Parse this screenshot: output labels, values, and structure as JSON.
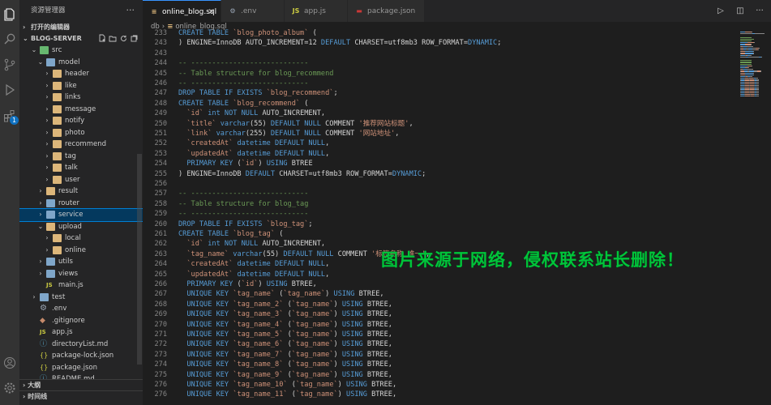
{
  "sidebar": {
    "title": "资源管理器",
    "open_editors_label": "打开的编辑器",
    "project_name": "BLOG-SERVER",
    "tree": [
      {
        "label": "src",
        "depth": 1,
        "expanded": true,
        "kind": "folder-green"
      },
      {
        "label": "model",
        "depth": 2,
        "expanded": true,
        "kind": "folder-special"
      },
      {
        "label": "header",
        "depth": 3,
        "expanded": false,
        "kind": "folder"
      },
      {
        "label": "like",
        "depth": 3,
        "expanded": false,
        "kind": "folder"
      },
      {
        "label": "links",
        "depth": 3,
        "expanded": false,
        "kind": "folder"
      },
      {
        "label": "message",
        "depth": 3,
        "expanded": false,
        "kind": "folder"
      },
      {
        "label": "notify",
        "depth": 3,
        "expanded": false,
        "kind": "folder"
      },
      {
        "label": "photo",
        "depth": 3,
        "expanded": false,
        "kind": "folder"
      },
      {
        "label": "recommend",
        "depth": 3,
        "expanded": false,
        "kind": "folder"
      },
      {
        "label": "tag",
        "depth": 3,
        "expanded": false,
        "kind": "folder"
      },
      {
        "label": "talk",
        "depth": 3,
        "expanded": false,
        "kind": "folder"
      },
      {
        "label": "user",
        "depth": 3,
        "expanded": false,
        "kind": "folder"
      },
      {
        "label": "result",
        "depth": 2,
        "expanded": false,
        "kind": "folder"
      },
      {
        "label": "router",
        "depth": 2,
        "expanded": false,
        "kind": "folder-special"
      },
      {
        "label": "service",
        "depth": 2,
        "expanded": false,
        "kind": "folder-special",
        "selected": true
      },
      {
        "label": "upload",
        "depth": 2,
        "expanded": true,
        "kind": "folder"
      },
      {
        "label": "local",
        "depth": 3,
        "expanded": false,
        "kind": "folder"
      },
      {
        "label": "online",
        "depth": 3,
        "expanded": false,
        "kind": "folder"
      },
      {
        "label": "utils",
        "depth": 2,
        "expanded": false,
        "kind": "folder-special"
      },
      {
        "label": "views",
        "depth": 2,
        "expanded": false,
        "kind": "folder-special"
      },
      {
        "label": "main.js",
        "depth": 2,
        "kind": "js"
      },
      {
        "label": "test",
        "depth": 1,
        "expanded": false,
        "kind": "folder-special"
      },
      {
        "label": ".env",
        "depth": 1,
        "kind": "gear"
      },
      {
        "label": ".gitignore",
        "depth": 1,
        "kind": "file"
      },
      {
        "label": "app.js",
        "depth": 1,
        "kind": "js"
      },
      {
        "label": "directoryList.md",
        "depth": 1,
        "kind": "md"
      },
      {
        "label": "package-lock.json",
        "depth": 1,
        "kind": "json"
      },
      {
        "label": "package.json",
        "depth": 1,
        "kind": "json"
      },
      {
        "label": "README.md",
        "depth": 1,
        "kind": "md"
      }
    ],
    "outline_label": "大纲",
    "timeline_label": "时间线"
  },
  "tabs": [
    {
      "label": "online_blog.sql",
      "icon": "database-icon",
      "active": true
    },
    {
      "label": ".env",
      "icon": "gear-icon",
      "active": false
    },
    {
      "label": "app.js",
      "icon": "js-icon",
      "active": false
    },
    {
      "label": "package.json",
      "icon": "npm-icon",
      "active": false
    }
  ],
  "breadcrumb": {
    "folder": "db",
    "file": "online_blog.sql"
  },
  "activity_badge": "1",
  "code_lines": [
    {
      "n": "233",
      "t": [
        [
          "kw",
          "CREATE TABLE "
        ],
        [
          "str",
          "`blog_photo_album`"
        ],
        [
          "ident",
          " ("
        ]
      ]
    },
    {
      "n": "243",
      "t": [
        [
          "ident",
          ") ENGINE=InnoDB AUTO_INCREMENT=12 "
        ],
        [
          "kw",
          "DEFAULT"
        ],
        [
          "ident",
          " CHARSET=utf8mb3 ROW_FORMAT="
        ],
        [
          "kw",
          "DYNAMIC"
        ],
        [
          "ident",
          ";"
        ]
      ]
    },
    {
      "n": "243",
      "t": []
    },
    {
      "n": "244",
      "t": [
        [
          "cm",
          "-- ----------------------------"
        ]
      ]
    },
    {
      "n": "245",
      "t": [
        [
          "cm",
          "-- Table structure for blog_recommend"
        ]
      ]
    },
    {
      "n": "246",
      "t": [
        [
          "cm",
          "-- ----------------------------"
        ]
      ]
    },
    {
      "n": "247",
      "t": [
        [
          "kw",
          "DROP TABLE IF EXISTS "
        ],
        [
          "str",
          "`blog_recommend`"
        ],
        [
          "ident",
          ";"
        ]
      ]
    },
    {
      "n": "248",
      "t": [
        [
          "kw",
          "CREATE TABLE "
        ],
        [
          "str",
          "`blog_recommend`"
        ],
        [
          "ident",
          " ("
        ]
      ]
    },
    {
      "n": "249",
      "t": [
        [
          "ident",
          "  "
        ],
        [
          "str",
          "`id`"
        ],
        [
          "kw",
          " int NOT NULL"
        ],
        [
          "ident",
          " AUTO_INCREMENT,"
        ]
      ]
    },
    {
      "n": "250",
      "t": [
        [
          "ident",
          "  "
        ],
        [
          "str",
          "`title`"
        ],
        [
          "kw",
          " varchar"
        ],
        [
          "ident",
          "(55) "
        ],
        [
          "kw",
          "DEFAULT NULL"
        ],
        [
          "ident",
          " COMMENT "
        ],
        [
          "str",
          "'推荐网站标题'"
        ],
        [
          "ident",
          ","
        ]
      ]
    },
    {
      "n": "251",
      "t": [
        [
          "ident",
          "  "
        ],
        [
          "str",
          "`link`"
        ],
        [
          "kw",
          " varchar"
        ],
        [
          "ident",
          "(255) "
        ],
        [
          "kw",
          "DEFAULT NULL"
        ],
        [
          "ident",
          " COMMENT "
        ],
        [
          "str",
          "'网站地址'"
        ],
        [
          "ident",
          ","
        ]
      ]
    },
    {
      "n": "252",
      "t": [
        [
          "ident",
          "  "
        ],
        [
          "str",
          "`createdAt`"
        ],
        [
          "kw",
          " datetime DEFAULT NULL"
        ],
        [
          "ident",
          ","
        ]
      ]
    },
    {
      "n": "253",
      "t": [
        [
          "ident",
          "  "
        ],
        [
          "str",
          "`updatedAt`"
        ],
        [
          "kw",
          " datetime DEFAULT NULL"
        ],
        [
          "ident",
          ","
        ]
      ]
    },
    {
      "n": "254",
      "t": [
        [
          "ident",
          "  "
        ],
        [
          "kw",
          "PRIMARY KEY"
        ],
        [
          "ident",
          " ("
        ],
        [
          "str",
          "`id`"
        ],
        [
          "ident",
          ") "
        ],
        [
          "kw",
          "USING"
        ],
        [
          "ident",
          " BTREE"
        ]
      ]
    },
    {
      "n": "255",
      "t": [
        [
          "ident",
          ") ENGINE=InnoDB "
        ],
        [
          "kw",
          "DEFAULT"
        ],
        [
          "ident",
          " CHARSET=utf8mb3 ROW_FORMAT="
        ],
        [
          "kw",
          "DYNAMIC"
        ],
        [
          "ident",
          ";"
        ]
      ]
    },
    {
      "n": "256",
      "t": []
    },
    {
      "n": "257",
      "t": [
        [
          "cm",
          "-- ----------------------------"
        ]
      ]
    },
    {
      "n": "258",
      "t": [
        [
          "cm",
          "-- Table structure for blog_tag"
        ]
      ]
    },
    {
      "n": "259",
      "t": [
        [
          "cm",
          "-- ----------------------------"
        ]
      ]
    },
    {
      "n": "260",
      "t": [
        [
          "kw",
          "DROP TABLE IF EXISTS "
        ],
        [
          "str",
          "`blog_tag`"
        ],
        [
          "ident",
          ";"
        ]
      ]
    },
    {
      "n": "261",
      "t": [
        [
          "kw",
          "CREATE TABLE "
        ],
        [
          "str",
          "`blog_tag`"
        ],
        [
          "ident",
          " ("
        ]
      ]
    },
    {
      "n": "262",
      "t": [
        [
          "ident",
          "  "
        ],
        [
          "str",
          "`id`"
        ],
        [
          "kw",
          " int NOT NULL"
        ],
        [
          "ident",
          " AUTO_INCREMENT,"
        ]
      ]
    },
    {
      "n": "263",
      "t": [
        [
          "ident",
          "  "
        ],
        [
          "str",
          "`tag_name`"
        ],
        [
          "kw",
          " varchar"
        ],
        [
          "ident",
          "(55) "
        ],
        [
          "kw",
          "DEFAULT NULL"
        ],
        [
          "ident",
          " COMMENT "
        ],
        [
          "str",
          "'标签名称 唯一'"
        ],
        [
          "ident",
          ","
        ]
      ]
    },
    {
      "n": "264",
      "t": [
        [
          "ident",
          "  "
        ],
        [
          "str",
          "`createdAt`"
        ],
        [
          "kw",
          " datetime DEFAULT NULL"
        ],
        [
          "ident",
          ","
        ]
      ]
    },
    {
      "n": "265",
      "t": [
        [
          "ident",
          "  "
        ],
        [
          "str",
          "`updatedAt`"
        ],
        [
          "kw",
          " datetime DEFAULT NULL"
        ],
        [
          "ident",
          ","
        ]
      ]
    },
    {
      "n": "266",
      "t": [
        [
          "ident",
          "  "
        ],
        [
          "kw",
          "PRIMARY KEY"
        ],
        [
          "ident",
          " ("
        ],
        [
          "str",
          "`id`"
        ],
        [
          "ident",
          ") "
        ],
        [
          "kw",
          "USING"
        ],
        [
          "ident",
          " BTREE,"
        ]
      ]
    },
    {
      "n": "267",
      "t": [
        [
          "ident",
          "  "
        ],
        [
          "kw",
          "UNIQUE KEY"
        ],
        [
          "ident",
          " "
        ],
        [
          "str",
          "`tag_name`"
        ],
        [
          "ident",
          " ("
        ],
        [
          "str",
          "`tag_name`"
        ],
        [
          "ident",
          ") "
        ],
        [
          "kw",
          "USING"
        ],
        [
          "ident",
          " BTREE,"
        ]
      ]
    },
    {
      "n": "268",
      "t": [
        [
          "ident",
          "  "
        ],
        [
          "kw",
          "UNIQUE KEY"
        ],
        [
          "ident",
          " "
        ],
        [
          "str",
          "`tag_name_2`"
        ],
        [
          "ident",
          " ("
        ],
        [
          "str",
          "`tag_name`"
        ],
        [
          "ident",
          ") "
        ],
        [
          "kw",
          "USING"
        ],
        [
          "ident",
          " BTREE,"
        ]
      ]
    },
    {
      "n": "269",
      "t": [
        [
          "ident",
          "  "
        ],
        [
          "kw",
          "UNIQUE KEY"
        ],
        [
          "ident",
          " "
        ],
        [
          "str",
          "`tag_name_3`"
        ],
        [
          "ident",
          " ("
        ],
        [
          "str",
          "`tag_name`"
        ],
        [
          "ident",
          ") "
        ],
        [
          "kw",
          "USING"
        ],
        [
          "ident",
          " BTREE,"
        ]
      ]
    },
    {
      "n": "270",
      "t": [
        [
          "ident",
          "  "
        ],
        [
          "kw",
          "UNIQUE KEY"
        ],
        [
          "ident",
          " "
        ],
        [
          "str",
          "`tag_name_4`"
        ],
        [
          "ident",
          " ("
        ],
        [
          "str",
          "`tag_name`"
        ],
        [
          "ident",
          ") "
        ],
        [
          "kw",
          "USING"
        ],
        [
          "ident",
          " BTREE,"
        ]
      ]
    },
    {
      "n": "271",
      "t": [
        [
          "ident",
          "  "
        ],
        [
          "kw",
          "UNIQUE KEY"
        ],
        [
          "ident",
          " "
        ],
        [
          "str",
          "`tag_name_5`"
        ],
        [
          "ident",
          " ("
        ],
        [
          "str",
          "`tag_name`"
        ],
        [
          "ident",
          ") "
        ],
        [
          "kw",
          "USING"
        ],
        [
          "ident",
          " BTREE,"
        ]
      ]
    },
    {
      "n": "272",
      "t": [
        [
          "ident",
          "  "
        ],
        [
          "kw",
          "UNIQUE KEY"
        ],
        [
          "ident",
          " "
        ],
        [
          "str",
          "`tag_name_6`"
        ],
        [
          "ident",
          " ("
        ],
        [
          "str",
          "`tag_name`"
        ],
        [
          "ident",
          ") "
        ],
        [
          "kw",
          "USING"
        ],
        [
          "ident",
          " BTREE,"
        ]
      ]
    },
    {
      "n": "273",
      "t": [
        [
          "ident",
          "  "
        ],
        [
          "kw",
          "UNIQUE KEY"
        ],
        [
          "ident",
          " "
        ],
        [
          "str",
          "`tag_name_7`"
        ],
        [
          "ident",
          " ("
        ],
        [
          "str",
          "`tag_name`"
        ],
        [
          "ident",
          ") "
        ],
        [
          "kw",
          "USING"
        ],
        [
          "ident",
          " BTREE,"
        ]
      ]
    },
    {
      "n": "274",
      "t": [
        [
          "ident",
          "  "
        ],
        [
          "kw",
          "UNIQUE KEY"
        ],
        [
          "ident",
          " "
        ],
        [
          "str",
          "`tag_name_8`"
        ],
        [
          "ident",
          " ("
        ],
        [
          "str",
          "`tag_name`"
        ],
        [
          "ident",
          ") "
        ],
        [
          "kw",
          "USING"
        ],
        [
          "ident",
          " BTREE,"
        ]
      ]
    },
    {
      "n": "275",
      "t": [
        [
          "ident",
          "  "
        ],
        [
          "kw",
          "UNIQUE KEY"
        ],
        [
          "ident",
          " "
        ],
        [
          "str",
          "`tag_name_9`"
        ],
        [
          "ident",
          " ("
        ],
        [
          "str",
          "`tag_name`"
        ],
        [
          "ident",
          ") "
        ],
        [
          "kw",
          "USING"
        ],
        [
          "ident",
          " BTREE,"
        ]
      ]
    },
    {
      "n": "276",
      "t": [
        [
          "ident",
          "  "
        ],
        [
          "kw",
          "UNIQUE KEY"
        ],
        [
          "ident",
          " "
        ],
        [
          "str",
          "`tag_name_10`"
        ],
        [
          "ident",
          " ("
        ],
        [
          "str",
          "`tag_name`"
        ],
        [
          "ident",
          ") "
        ],
        [
          "kw",
          "USING"
        ],
        [
          "ident",
          " BTREE,"
        ]
      ]
    },
    {
      "n": "276",
      "t": [
        [
          "ident",
          "  "
        ],
        [
          "kw",
          "UNIQUE KEY"
        ],
        [
          "ident",
          " "
        ],
        [
          "str",
          "`tag_name_11`"
        ],
        [
          "ident",
          " ("
        ],
        [
          "str",
          "`tag_name`"
        ],
        [
          "ident",
          ") "
        ],
        [
          "kw",
          "USING"
        ],
        [
          "ident",
          " BTREE,"
        ]
      ]
    }
  ],
  "watermark": "图片来源于网络，侵权联系站长删除！",
  "colors": {
    "accent": "#3794ff",
    "selection": "#04395e",
    "keyword": "#569cd6",
    "comment": "#6a9955",
    "string": "#ce9178",
    "watermark": "#00c43a"
  }
}
